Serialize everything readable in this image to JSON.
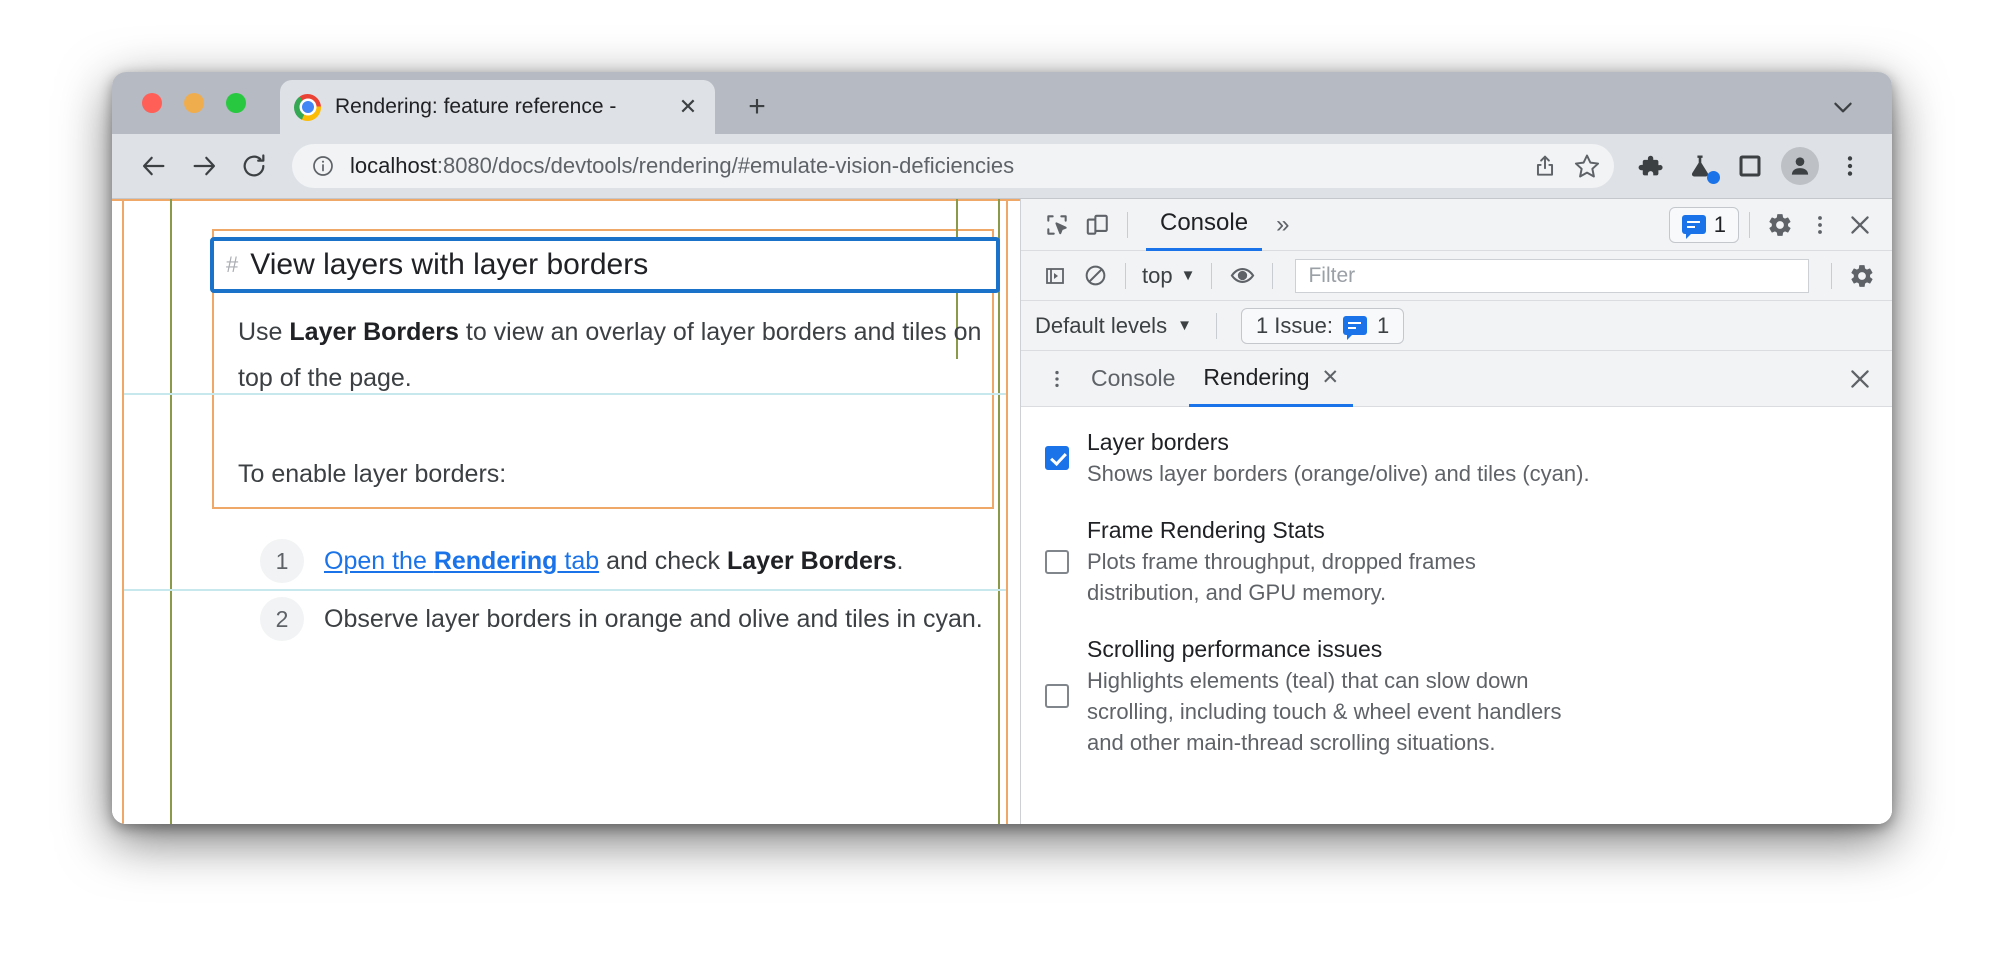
{
  "browser": {
    "tab": {
      "title": "Rendering: feature reference -",
      "close_label": "✕",
      "favicon": "chrome-logo-icon"
    },
    "new_tab_label": "+",
    "tabstrip_chevron": "chevron-down-icon",
    "toolbar": {
      "back": "back-arrow-icon",
      "forward": "forward-arrow-icon",
      "reload": "reload-icon",
      "site_info": "info-circle-icon",
      "url_host": "localhost",
      "url_rest": ":8080/docs/devtools/rendering/#emulate-vision-deficiencies",
      "share": "share-icon",
      "bookmark": "star-icon",
      "extensions": "puzzle-icon",
      "labs": "flask-icon",
      "side_panel": "side-panel-icon",
      "profile": "avatar-icon",
      "menu": "three-dot-menu-icon"
    }
  },
  "page": {
    "heading_hash": "#",
    "heading": "View layers with layer borders",
    "paragraph_1": {
      "pre": "Use ",
      "strong": "Layer Borders",
      "post": " to view an overlay of layer borders and tiles on"
    },
    "paragraph_1_line2": "top of the page.",
    "paragraph_2": "To enable layer borders:",
    "steps": [
      {
        "number": "1",
        "link_pre": "Open the ",
        "link_strong": "Rendering",
        "link_post": " tab",
        "mid": " and check ",
        "strong": "Layer Borders",
        "end": "."
      },
      {
        "number": "2",
        "text": "Observe layer borders in orange and olive and tiles in cyan."
      }
    ]
  },
  "devtools": {
    "inspect_icon": "inspect-element-icon",
    "device_toolbar_icon": "device-toolbar-icon",
    "active_panel": "Console",
    "more_panels": "»",
    "issue_badge": {
      "icon": "issue-bubble-icon",
      "count": "1"
    },
    "settings_icon": "gear-icon",
    "menu_icon": "three-dot-menu-icon",
    "close_icon": "close-icon",
    "console_toolbar": {
      "sidebar_icon": "console-sidebar-icon",
      "clear_icon": "clear-console-icon",
      "context": "top",
      "context_caret": "▼",
      "eye_icon": "live-expression-icon",
      "filter_placeholder": "Filter",
      "settings_icon": "gear-icon"
    },
    "levels_row": {
      "levels_label": "Default levels",
      "levels_caret": "▼",
      "issues_label": "1 Issue:",
      "issues_count": "1",
      "issues_icon": "issue-bubble-icon"
    },
    "drawer": {
      "menu_icon": "three-dot-menu-icon",
      "tabs": [
        {
          "label": "Console",
          "active": false,
          "closable": false
        },
        {
          "label": "Rendering",
          "active": true,
          "closable": true,
          "close_label": "✕"
        }
      ],
      "close_label": "✕"
    },
    "rendering_options": [
      {
        "checked": true,
        "title": "Layer borders",
        "desc": "Shows layer borders (orange/olive) and tiles (cyan)."
      },
      {
        "checked": false,
        "title": "Frame Rendering Stats",
        "desc": "Plots frame throughput, dropped frames distribution, and GPU memory."
      },
      {
        "checked": false,
        "title": "Scrolling performance issues",
        "desc": "Highlights elements (teal) that can slow down scrolling, including touch & wheel event handlers and other main-thread scrolling situations."
      }
    ]
  },
  "colors": {
    "layer_border_orange": "#f0a868",
    "layer_border_olive": "#8a9a4b",
    "tile_cyan": "#c7e8ec",
    "selected_layer_blue": "#1a73c8",
    "accent_blue": "#1a73e8"
  }
}
